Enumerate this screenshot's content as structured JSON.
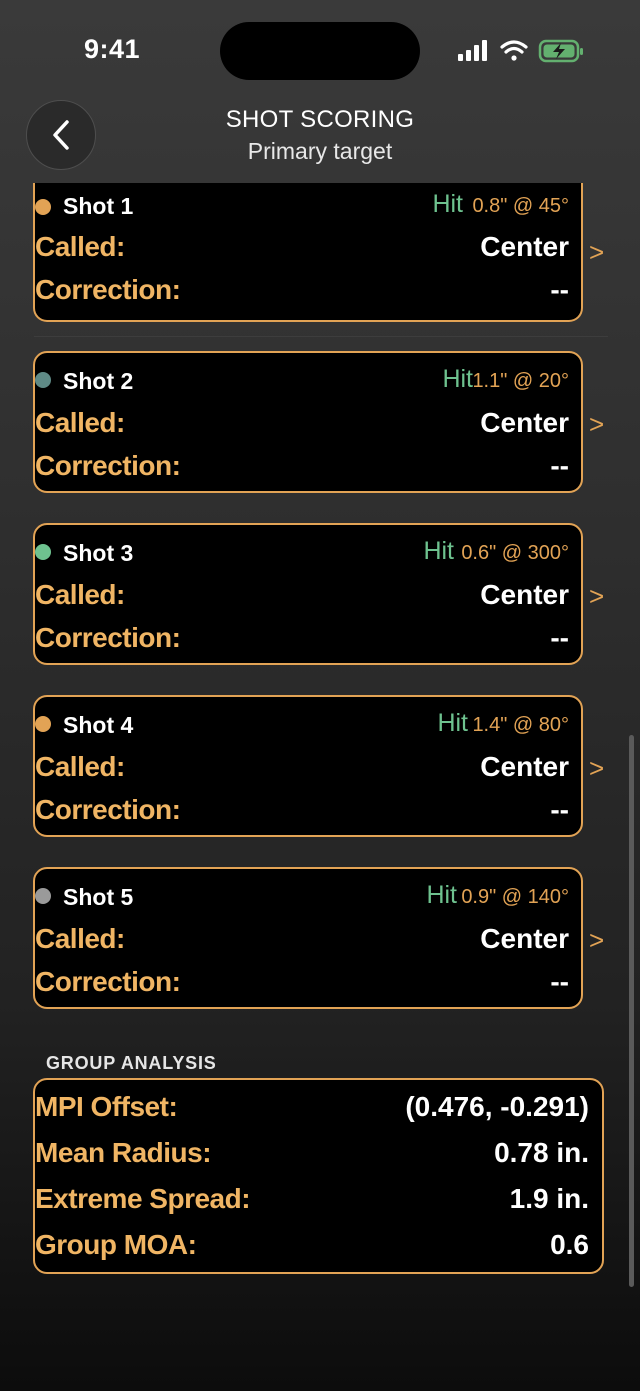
{
  "status_bar": {
    "time": "9:41"
  },
  "nav": {
    "title": "SHOT SCORING",
    "subtitle": "Primary target"
  },
  "labels": {
    "called": "Called:",
    "correction": "Correction:"
  },
  "chevron": ">",
  "shots": [
    {
      "name": "Shot 1",
      "result": "Hit",
      "detail": "0.8\" @ 45°",
      "called": "Center",
      "correction": "--",
      "dot_color": "#e2a355"
    },
    {
      "name": "Shot 2",
      "result": "Hit",
      "detail": "1.1\" @ 20°",
      "called": "Center",
      "correction": "--",
      "dot_color": "#5f8a86"
    },
    {
      "name": "Shot 3",
      "result": "Hit",
      "detail": "0.6\" @ 300°",
      "called": "Center",
      "correction": "--",
      "dot_color": "#6ec28f"
    },
    {
      "name": "Shot 4",
      "result": "Hit",
      "detail": "1.4\" @ 80°",
      "called": "Center",
      "correction": "--",
      "dot_color": "#e2a355"
    },
    {
      "name": "Shot 5",
      "result": "Hit",
      "detail": "0.9\" @ 140°",
      "called": "Center",
      "correction": "--",
      "dot_color": "#9a9a9a"
    }
  ],
  "group_analysis": {
    "header": "GROUP ANALYSIS",
    "rows": [
      {
        "label": "MPI Offset:",
        "value": "(0.476, -0.291)"
      },
      {
        "label": "Mean Radius:",
        "value": "0.78 in."
      },
      {
        "label": "Extreme Spread:",
        "value": "1.9 in."
      },
      {
        "label": "Group MOA:",
        "value": "0.6"
      }
    ]
  },
  "colors": {
    "accent": "#e2a355",
    "label": "#f0b564",
    "hit": "#6ec28f",
    "card": "#000000"
  }
}
